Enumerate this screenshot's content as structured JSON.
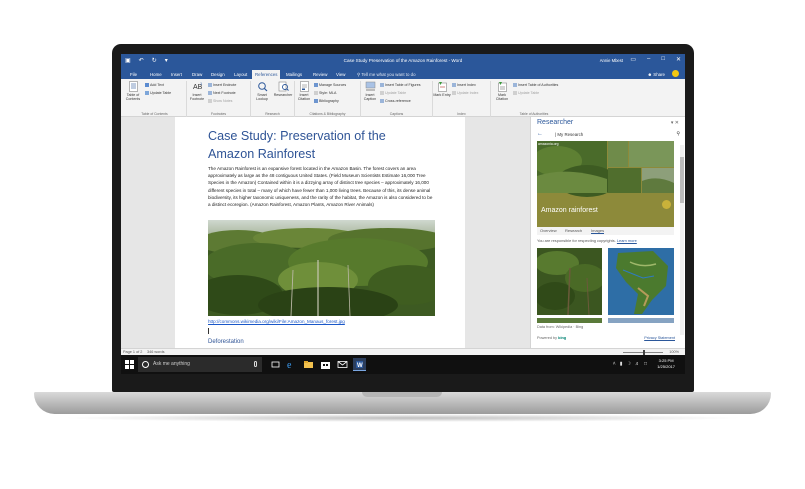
{
  "window": {
    "title": "Case Study Preservation of the Amazon Rainforest  -  Word",
    "user": "Annie Mbest",
    "qat": [
      "save-icon",
      "undo-icon",
      "redo-icon",
      "customize-icon"
    ]
  },
  "tabs": [
    "File",
    "Home",
    "Insert",
    "Draw",
    "Design",
    "Layout",
    "References",
    "Mailings",
    "Review",
    "View"
  ],
  "active_tab": "References",
  "tell_me": "Tell me what you want to do",
  "share": "Share",
  "ribbon": {
    "toc": {
      "label": "Table of Contents",
      "add_text": "Add Text",
      "update_table": "Update Table",
      "group": "Table of Contents"
    },
    "footnotes": {
      "insert_footnote": "Insert Footnote",
      "insert_endnote": "Insert Endnote",
      "next_footnote": "Next Footnote",
      "show_notes": "Show Notes",
      "group": "Footnotes"
    },
    "research": {
      "smart_lookup": "Smart Lookup",
      "researcher": "Researcher",
      "group": "Research"
    },
    "citations": {
      "insert_citation": "Insert Citation",
      "manage_sources": "Manage Sources",
      "style": "Style: MLA",
      "bibliography": "Bibliography",
      "group": "Citations & Bibliography"
    },
    "captions": {
      "insert_caption": "Insert Caption",
      "insert_tof": "Insert Table of Figures",
      "update_table": "Update Table",
      "cross_reference": "Cross-reference",
      "group": "Captions"
    },
    "index": {
      "mark_entry": "Mark Entry",
      "insert_index": "Insert Index",
      "update_index": "Update Index",
      "group": "Index"
    },
    "authorities": {
      "mark_citation": "Mark Citation",
      "insert_toa": "Insert Table of Authorities",
      "update_table": "Update Table",
      "group": "Table of Authorities"
    }
  },
  "document": {
    "title": "Case Study: Preservation of the Amazon Rainforest",
    "body": "The Amazon Rainforest is an expansive forest located in the Amazon Basin.  The forest covers an area approximately as large as the 48 contiguous United States. (Field Museum Scientists Estimate 16,000 Tree Species in the Amazon)  Contained within it is a dizzying array of distinct tree species – approximately 16,000 different species in total – many of which have fewer than 1,000 living trees. Because of this, its dense animal biodiversity, its higher taxonomic uniqueness, and the rarity of the habitat, the Amazon is also considered to be a distinct ecoregion. (Amazon Rainforest, Amazon Plants, Amazon River Animals)",
    "link": "http://commons.wikimedia.org/wiki/File:Amazon_Manaus_forest.jpg",
    "next_heading": "Deforestation"
  },
  "researcher": {
    "title": "Researcher",
    "breadcrumb": "My Research",
    "card_title": "Amazon rainforest",
    "card_source": "amazonia.org",
    "tabs": [
      "Overview",
      "Research",
      "Images"
    ],
    "notice": "You are responsible for respecting copyrights.",
    "learn_more": "Learn more",
    "data_source": "Data from: Wikipedia · Bing",
    "powered_by": "Powered by",
    "bing": "bing",
    "privacy": "Privacy Statement"
  },
  "status": {
    "page": "Page 1 of 2",
    "words": "346 words",
    "zoom": "100%"
  },
  "taskbar": {
    "search_placeholder": "Ask me anything",
    "time": "3:25 PM",
    "date": "1/25/2017",
    "apps": [
      "task-view-icon",
      "edge-icon",
      "file-explorer-icon",
      "store-icon",
      "mail-icon",
      "word-icon"
    ]
  },
  "colors": {
    "word_blue": "#2b579a",
    "heading_blue": "#2f5496",
    "card_olive": "#8d8a3a",
    "taskbar": "#101010"
  }
}
